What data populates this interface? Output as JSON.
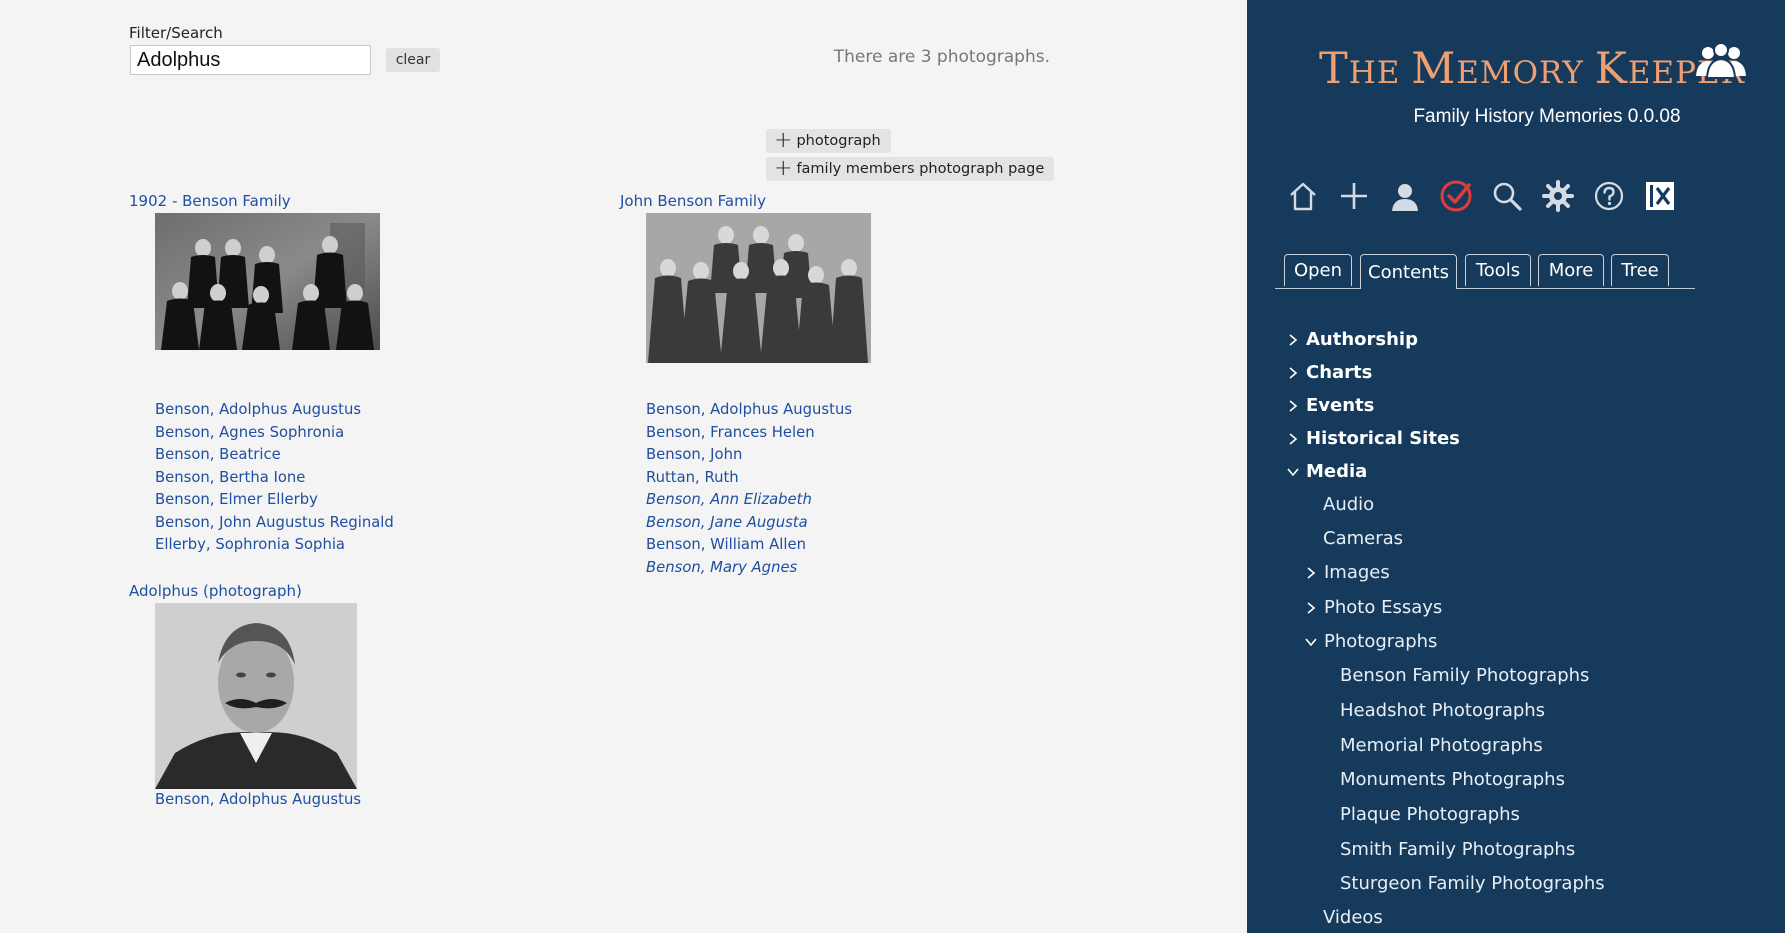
{
  "filter": {
    "label": "Filter/Search",
    "value": "Adolphus",
    "clear_label": "clear"
  },
  "count_text": "There are 3 photographs.",
  "actions": {
    "add_photograph": "photograph",
    "add_family_page": "family members photograph page"
  },
  "photos": [
    {
      "title": "1902 - Benson Family",
      "image_alt": "group portrait photograph",
      "members": [
        {
          "name": "Benson, Adolphus Augustus",
          "italic": false
        },
        {
          "name": "Benson, Agnes Sophronia",
          "italic": false
        },
        {
          "name": "Benson, Beatrice",
          "italic": false
        },
        {
          "name": "Benson, Bertha Ione",
          "italic": false
        },
        {
          "name": "Benson, Elmer Ellerby",
          "italic": false
        },
        {
          "name": "Benson, John Augustus Reginald",
          "italic": false
        },
        {
          "name": "Ellerby, Sophronia Sophia",
          "italic": false
        }
      ]
    },
    {
      "title": "John Benson Family",
      "image_alt": "group portrait photograph",
      "members": [
        {
          "name": "Benson, Adolphus Augustus",
          "italic": false
        },
        {
          "name": "Benson, Frances Helen",
          "italic": false
        },
        {
          "name": "Benson, John",
          "italic": false
        },
        {
          "name": "Ruttan, Ruth",
          "italic": false
        },
        {
          "name": "Benson, Ann Elizabeth",
          "italic": true
        },
        {
          "name": "Benson, Jane Augusta",
          "italic": true
        },
        {
          "name": "Benson, William Allen",
          "italic": false
        },
        {
          "name": "Benson, Mary Agnes",
          "italic": true
        }
      ]
    },
    {
      "title": "Adolphus (photograph)",
      "image_alt": "portrait photograph",
      "members": [
        {
          "name": "Benson, Adolphus Augustus",
          "italic": false
        }
      ]
    }
  ],
  "sidebar": {
    "title_parts": [
      "T",
      "HE ",
      "M",
      "EMORY ",
      "K",
      "EEPER"
    ],
    "subtitle": "Family History Memories 0.0.08",
    "toolbar_icons": [
      "home-icon",
      "plus-icon",
      "person-icon",
      "check-circle-icon",
      "search-icon",
      "gear-icon",
      "help-icon",
      "close-box-icon"
    ],
    "accent": "#e03a3a",
    "tabs": [
      "Open",
      "Contents",
      "Tools",
      "More",
      "Tree"
    ],
    "active_tab": "Contents",
    "tree": [
      {
        "label": "Authorship",
        "level": 0,
        "state": "collapsed"
      },
      {
        "label": "Charts",
        "level": 0,
        "state": "collapsed"
      },
      {
        "label": "Events",
        "level": 0,
        "state": "collapsed"
      },
      {
        "label": "Historical Sites",
        "level": 0,
        "state": "collapsed"
      },
      {
        "label": "Media",
        "level": 0,
        "state": "expanded"
      },
      {
        "label": "Audio",
        "level": 1,
        "state": "leaf"
      },
      {
        "label": "Cameras",
        "level": 1,
        "state": "leaf"
      },
      {
        "label": "Images",
        "level": 1,
        "state": "collapsed"
      },
      {
        "label": "Photo Essays",
        "level": 1,
        "state": "collapsed"
      },
      {
        "label": "Photographs",
        "level": 1,
        "state": "expanded"
      },
      {
        "label": "Benson Family Photographs",
        "level": 2,
        "state": "leaf"
      },
      {
        "label": "Headshot Photographs",
        "level": 2,
        "state": "leaf"
      },
      {
        "label": "Memorial Photographs",
        "level": 2,
        "state": "leaf"
      },
      {
        "label": "Monuments Photographs",
        "level": 2,
        "state": "leaf"
      },
      {
        "label": "Plaque Photographs",
        "level": 2,
        "state": "leaf"
      },
      {
        "label": "Smith Family Photographs",
        "level": 2,
        "state": "leaf"
      },
      {
        "label": "Sturgeon Family Photographs",
        "level": 2,
        "state": "leaf"
      },
      {
        "label": "Videos",
        "level": 1,
        "state": "leaf"
      }
    ]
  }
}
